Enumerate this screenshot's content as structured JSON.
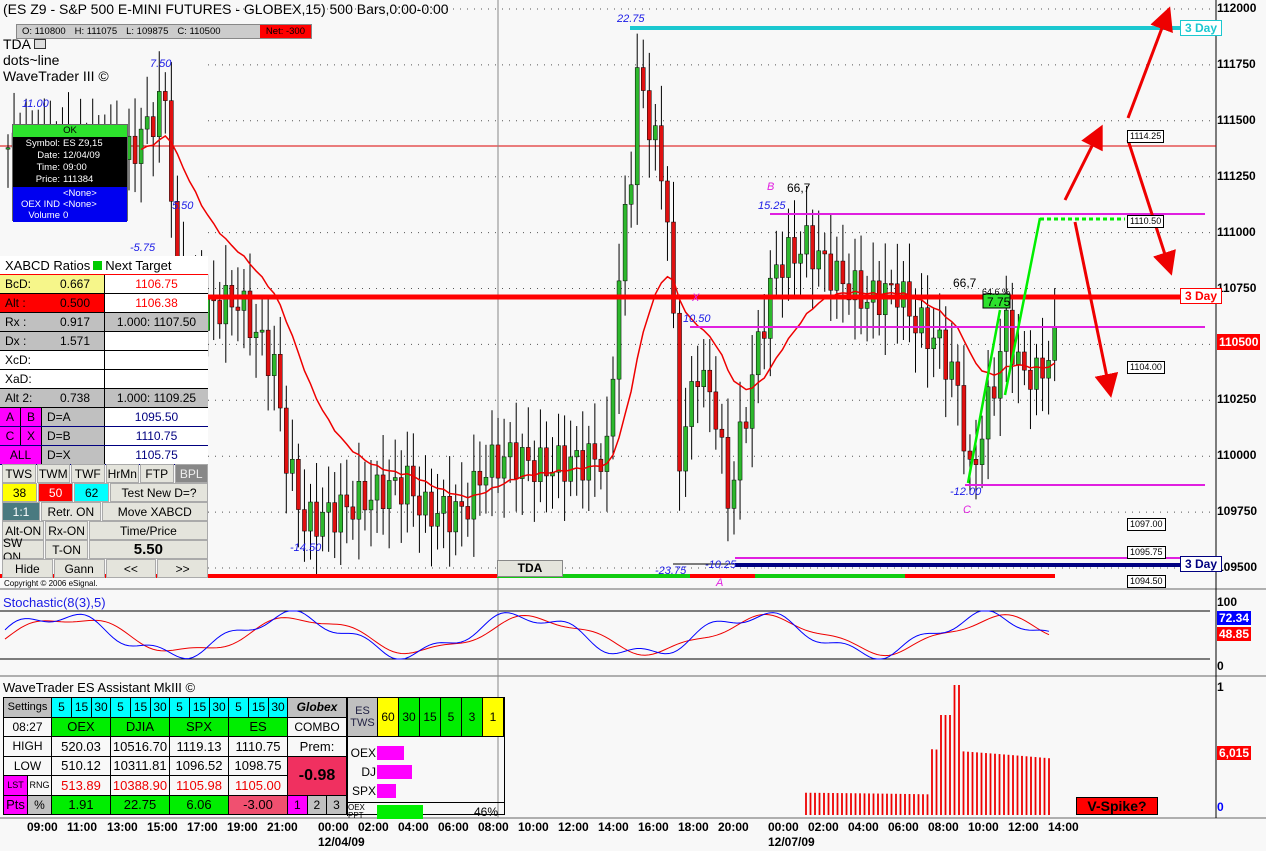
{
  "header": {
    "title": "(ES Z9 - S&P 500 E-MINI FUTURES - GLOBEX,15) 500 Bars,0:00-0:00",
    "open": "O: 110800",
    "high": "H: 111075",
    "low": "L: 109875",
    "close": "C: 110500",
    "net": "Net: -300",
    "studies": [
      "TDA",
      "dots~line",
      "WaveTrader III ©"
    ]
  },
  "cursor_info": {
    "status": "OK",
    "rows": [
      [
        "Symbol:",
        "ES Z9,15"
      ],
      [
        "Date:",
        "12/04/09"
      ],
      [
        "Time:",
        "09:00"
      ],
      [
        "Price:",
        "111384"
      ]
    ],
    "rows2": [
      [
        "",
        "<None>"
      ],
      [
        "OEX IND",
        "<None>"
      ],
      [
        "Volume",
        "0"
      ]
    ]
  },
  "wave_labels": [
    {
      "t": "11.00",
      "c": "#1a1ae6"
    },
    {
      "t": "7.50",
      "c": "#1a1ae6"
    },
    {
      "t": "5.50",
      "c": "#1a1ae6"
    },
    {
      "t": "-5.75",
      "c": "#1a1ae6"
    },
    {
      "t": "-14.50",
      "c": "#1a1ae6"
    },
    {
      "t": "22.75",
      "c": "#1a1ae6"
    },
    {
      "t": "-23.75",
      "c": "#1a1ae6"
    },
    {
      "t": "-10.25",
      "c": "#1a1ae6"
    },
    {
      "t": "10.50",
      "c": "#1a1ae6"
    },
    {
      "t": "15.25",
      "c": "#1a1ae6"
    },
    {
      "t": "-12.00",
      "c": "#1a1ae6"
    },
    {
      "t": "B",
      "c": "#e020e0"
    },
    {
      "t": "66,7",
      "c": "#000"
    },
    {
      "t": "X",
      "c": "#e020e0"
    },
    {
      "t": "A",
      "c": "#e020e0"
    },
    {
      "t": "C",
      "c": "#e020e0"
    },
    {
      "t": "66,7",
      "c": "#000"
    },
    {
      "t": "64.6 %",
      "c": "#000"
    },
    {
      "t": "7.75",
      "c": "#000"
    }
  ],
  "xabcd": {
    "title": "XABCD Ratios",
    "next": "Next Target",
    "rows": [
      {
        "a": "BcD:",
        "b": "0.667",
        "c": "1106.75",
        "bg": "#f6f68a",
        "cc": "#f00",
        "cbg": "#fff"
      },
      {
        "a": "Alt  :",
        "b": "0.500",
        "c": "1106.38",
        "bg": "#f00",
        "cc": "#f00",
        "cbg": "#fff"
      },
      {
        "a": "Rx   :",
        "b": "0.917",
        "c": "1.000: 1107.50",
        "bg": "#c0c0c0",
        "cc": "#000",
        "cbg": "#c0c0c0"
      },
      {
        "a": "Dx   :",
        "b": "1.571",
        "c": "",
        "bg": "#c0c0c0",
        "cc": "#000",
        "cbg": "#fff"
      },
      {
        "a": "XcD:",
        "b": "",
        "c": "",
        "bg": "#fff",
        "cc": "#000",
        "cbg": "#fff"
      },
      {
        "a": "XaD:",
        "b": "",
        "c": "",
        "bg": "#fff",
        "cc": "#000",
        "cbg": "#fff"
      },
      {
        "a": "Alt 2:",
        "b": "0.738",
        "c": "1.000: 1109.25",
        "bg": "#c0c0c0",
        "cc": "#000",
        "cbg": "#c0c0c0"
      }
    ],
    "d_rows": [
      {
        "k1": "A",
        "k2": "B",
        "d": "D=A",
        "v": "1095.50"
      },
      {
        "k1": "C",
        "k2": "X",
        "d": "D=B",
        "v": "1110.75"
      },
      {
        "k1": "ALL",
        "k2": "",
        "d": "D=X",
        "v": "1105.75"
      }
    ]
  },
  "buttons": {
    "r1": [
      "TWS",
      "TWM",
      "TWF",
      "HrMn",
      "FTP",
      "BPL"
    ],
    "r2": [
      "38",
      "50",
      "62",
      "Test New D=?"
    ],
    "r3": [
      "1:1",
      "Retr. ON",
      "Move XABCD"
    ],
    "r4": [
      "Alt-ON",
      "Rx-ON",
      "Time/Price"
    ],
    "r5": [
      "SW ON",
      "T-ON",
      "5.50"
    ],
    "r6": [
      "Hide",
      "Gann",
      "<<",
      ">>"
    ]
  },
  "copyright": "Copyright © 2006 eSignal.",
  "tda_button": "TDA",
  "price_axis": [
    "112000",
    "111750",
    "111500",
    "111250",
    "111000",
    "110750",
    "110500",
    "110250",
    "110000",
    "109750",
    "109500"
  ],
  "last_price": "110500",
  "price_boxes": [
    "1114.25",
    "1110.50",
    "1104.00",
    "1097.00",
    "1095.75",
    "1094.50"
  ],
  "day_labels": {
    "cyan": "3 Day",
    "red": "3 Day",
    "navy": "3 Day"
  },
  "stoch": {
    "title": "Stochastic(8(3),5)",
    "axis": [
      "100",
      "0"
    ],
    "k": "72.34",
    "d": "48.85"
  },
  "volume": {
    "axis": [
      "1",
      "0"
    ],
    "value": "6,015",
    "vspike": "V-Spike?"
  },
  "assistant": {
    "title": "WaveTrader ES Assistant MkIII ©",
    "settings": "Settings",
    "tfs": [
      "5",
      "15",
      "30"
    ],
    "globex": "Globex",
    "time": "08:27",
    "combo": "COMBO",
    "prem": "Prem:",
    "prem_val": "-0.98",
    "cols": [
      "OEX",
      "DJIA",
      "SPX",
      "ES"
    ],
    "high_label": "HIGH",
    "low_label": "LOW",
    "lst": "LST",
    "rng": "RNG",
    "pts": "Pts",
    "pct": "%",
    "high": [
      "520.03",
      "10516.70",
      "1119.13",
      "1110.75"
    ],
    "low": [
      "510.12",
      "10311.81",
      "1096.52",
      "1098.75"
    ],
    "last": [
      "513.89",
      "10388.90",
      "1105.98",
      "1105.00"
    ],
    "change": [
      "1.91",
      "22.75",
      "6.06",
      "-3.00"
    ],
    "pages": [
      "1",
      "2",
      "3"
    ],
    "tws_label": "ES TWS",
    "tws": [
      "60",
      "30",
      "15",
      "5",
      "3",
      "1"
    ],
    "bars": [
      {
        "l": "OEX",
        "v": 0.48
      },
      {
        "l": "DJ",
        "v": 0.62
      },
      {
        "l": "SPX",
        "v": 0.33
      }
    ],
    "ppt_label": "OEX PPT",
    "ppt": 0.46,
    "ppt_text": "46%"
  },
  "time_axis": [
    "09:00",
    "11:00",
    "13:00",
    "15:00",
    "17:00",
    "19:00",
    "21:00",
    "00:00",
    "02:00",
    "04:00",
    "06:00",
    "08:00",
    "10:00",
    "12:00",
    "14:00",
    "16:00",
    "18:00",
    "20:00",
    "00:00",
    "02:00",
    "04:00",
    "06:00",
    "08:00",
    "10:00",
    "12:00",
    "14:00"
  ],
  "dates": [
    "12/04/09",
    "12/07/09"
  ],
  "chart_data": {
    "type": "candlestick",
    "price_path": [
      [
        0,
        1113.8
      ],
      [
        20,
        1113.5
      ],
      [
        26,
        1116
      ],
      [
        28,
        1108
      ],
      [
        32,
        1106.5
      ],
      [
        38,
        1107
      ],
      [
        44,
        1104
      ],
      [
        46,
        1100
      ],
      [
        49,
        1097
      ],
      [
        55,
        1097.6
      ],
      [
        62,
        1098.5
      ],
      [
        66,
        1098.8
      ],
      [
        69,
        1097.5
      ],
      [
        75,
        1097.5
      ],
      [
        79,
        1099.5
      ],
      [
        83,
        1100
      ],
      [
        88,
        1099.5
      ],
      [
        99,
        1100
      ],
      [
        101,
        1108
      ],
      [
        103,
        1113
      ],
      [
        104,
        1117
      ],
      [
        107,
        1114
      ],
      [
        109,
        1111
      ],
      [
        111,
        1100
      ],
      [
        114,
        1104
      ],
      [
        117,
        1102
      ],
      [
        119,
        1098
      ],
      [
        122,
        1102
      ],
      [
        124,
        1105
      ],
      [
        127,
        1108.5
      ],
      [
        132,
        1109.5
      ],
      [
        137,
        1108
      ],
      [
        142,
        1107
      ],
      [
        147,
        1107.5
      ],
      [
        150,
        1106
      ],
      [
        154,
        1105
      ],
      [
        157,
        1103
      ],
      [
        159,
        1099
      ],
      [
        160,
        1100
      ],
      [
        164,
        1104.5
      ],
      [
        165,
        1106
      ],
      [
        167,
        1104
      ],
      [
        170,
        1103.5
      ],
      [
        173,
        1105
      ]
    ]
  }
}
